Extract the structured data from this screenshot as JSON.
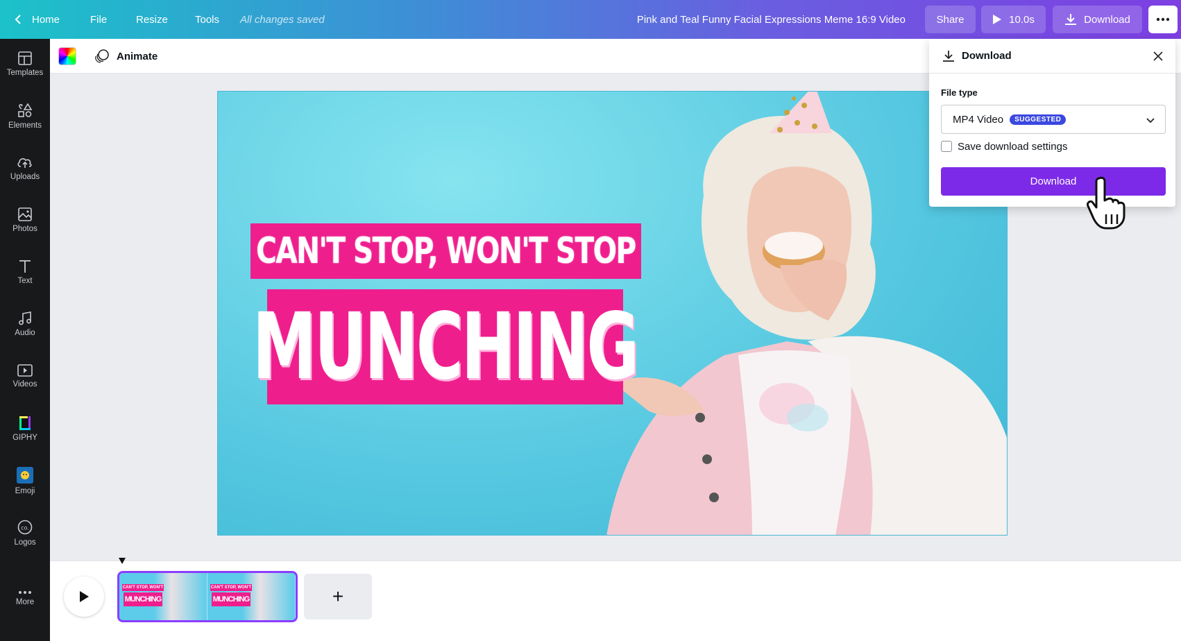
{
  "topbar": {
    "home": "Home",
    "file": "File",
    "resize": "Resize",
    "tools": "Tools",
    "saved_status": "All changes saved",
    "project_title": "Pink and Teal Funny Facial Expressions Meme 16:9 Video",
    "share": "Share",
    "duration": "10.0s",
    "download": "Download"
  },
  "sidebar": {
    "items": [
      {
        "label": "Templates",
        "icon": "templates-icon"
      },
      {
        "label": "Elements",
        "icon": "elements-icon"
      },
      {
        "label": "Uploads",
        "icon": "upload-icon"
      },
      {
        "label": "Photos",
        "icon": "photo-icon"
      },
      {
        "label": "Text",
        "icon": "text-icon"
      },
      {
        "label": "Audio",
        "icon": "music-icon"
      },
      {
        "label": "Videos",
        "icon": "video-icon"
      },
      {
        "label": "GIPHY",
        "icon": "giphy-icon"
      },
      {
        "label": "Emoji",
        "icon": "emoji-icon"
      },
      {
        "label": "Logos",
        "icon": "logo-icon"
      },
      {
        "label": "More",
        "icon": "more-icon"
      }
    ]
  },
  "toolbar": {
    "animate": "Animate"
  },
  "canvas": {
    "headline1": "CAN'T STOP, WON'T STOP",
    "headline2": "MUNCHING",
    "accent": "#ef1e8d",
    "background": "#55c7e0"
  },
  "timeline": {
    "clip_text1": "CAN'T STOP, WON'T STOP",
    "clip_text2": "MUNCHING",
    "add": "+"
  },
  "download_panel": {
    "title": "Download",
    "file_type_label": "File type",
    "file_type_value": "MP4 Video",
    "badge": "SUGGESTED",
    "save_settings": "Save download settings",
    "download_button": "Download",
    "button_color": "#7d2ae8"
  }
}
